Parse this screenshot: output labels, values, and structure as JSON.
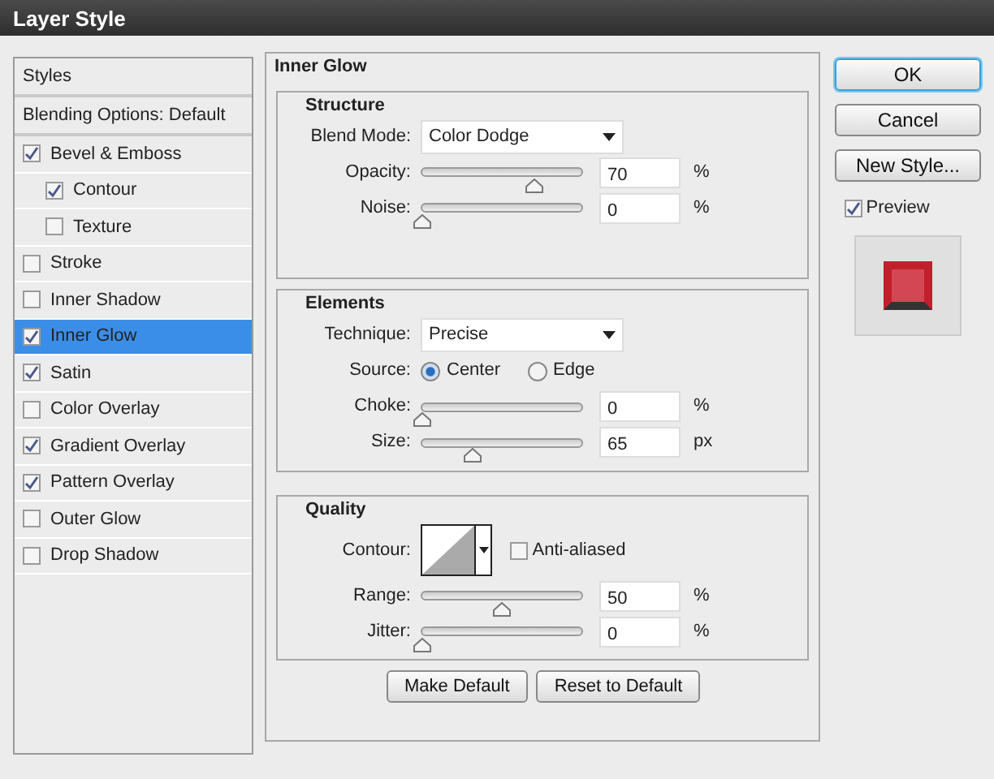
{
  "window": {
    "title": "Layer Style"
  },
  "sidebar": {
    "header": "Styles",
    "blending": "Blending Options: Default",
    "items": [
      {
        "label": "Bevel & Emboss",
        "checked": true,
        "selected": false,
        "children": [
          {
            "label": "Contour",
            "checked": true,
            "selected": false
          },
          {
            "label": "Texture",
            "checked": false,
            "selected": false
          }
        ]
      },
      {
        "label": "Stroke",
        "checked": false,
        "selected": false
      },
      {
        "label": "Inner Shadow",
        "checked": false,
        "selected": false
      },
      {
        "label": "Inner Glow",
        "checked": true,
        "selected": true
      },
      {
        "label": "Satin",
        "checked": true,
        "selected": false
      },
      {
        "label": "Color Overlay",
        "checked": false,
        "selected": false
      },
      {
        "label": "Gradient Overlay",
        "checked": true,
        "selected": false
      },
      {
        "label": "Pattern Overlay",
        "checked": true,
        "selected": false
      },
      {
        "label": "Outer Glow",
        "checked": false,
        "selected": false
      },
      {
        "label": "Drop Shadow",
        "checked": false,
        "selected": false
      }
    ]
  },
  "panel": {
    "title": "Inner Glow",
    "groups": [
      {
        "title": "Structure",
        "rows": [
          {
            "kind": "select",
            "label": "Blend Mode:",
            "value": "Color Dodge"
          },
          {
            "kind": "slider",
            "label": "Opacity:",
            "level": 0.7,
            "value": "70",
            "unit": "%"
          },
          {
            "kind": "slider",
            "label": "Noise:",
            "level": 0,
            "value": "0",
            "unit": "%"
          }
        ]
      },
      {
        "title": "Elements",
        "rows": [
          {
            "kind": "select",
            "label": "Technique:",
            "value": "Precise"
          },
          {
            "kind": "radio",
            "label": "Source:",
            "options": [
              {
                "label": "Center",
                "selected": true
              },
              {
                "label": "Edge",
                "selected": false
              }
            ]
          },
          {
            "kind": "slider",
            "label": "Choke:",
            "level": 0,
            "value": "0",
            "unit": "%"
          },
          {
            "kind": "slider",
            "label": "Size:",
            "level": 0.32,
            "value": "65",
            "unit": "px"
          }
        ]
      },
      {
        "title": "Quality",
        "rows": [
          {
            "kind": "contour",
            "label": "Contour:",
            "checkbox": {
              "label": "Anti-aliased",
              "checked": false
            }
          },
          {
            "kind": "slider",
            "label": "Range:",
            "level": 0.5,
            "value": "50",
            "unit": "%"
          },
          {
            "kind": "slider",
            "label": "Jitter:",
            "level": 0,
            "value": "0",
            "unit": "%"
          }
        ]
      }
    ],
    "buttons": [
      "Make Default",
      "Reset to Default"
    ]
  },
  "actions": [
    {
      "label": "OK",
      "default": true
    },
    {
      "label": "Cancel",
      "default": false
    },
    {
      "label": "New Style...",
      "default": false
    }
  ],
  "preview": {
    "label": "Preview",
    "checked": true
  }
}
